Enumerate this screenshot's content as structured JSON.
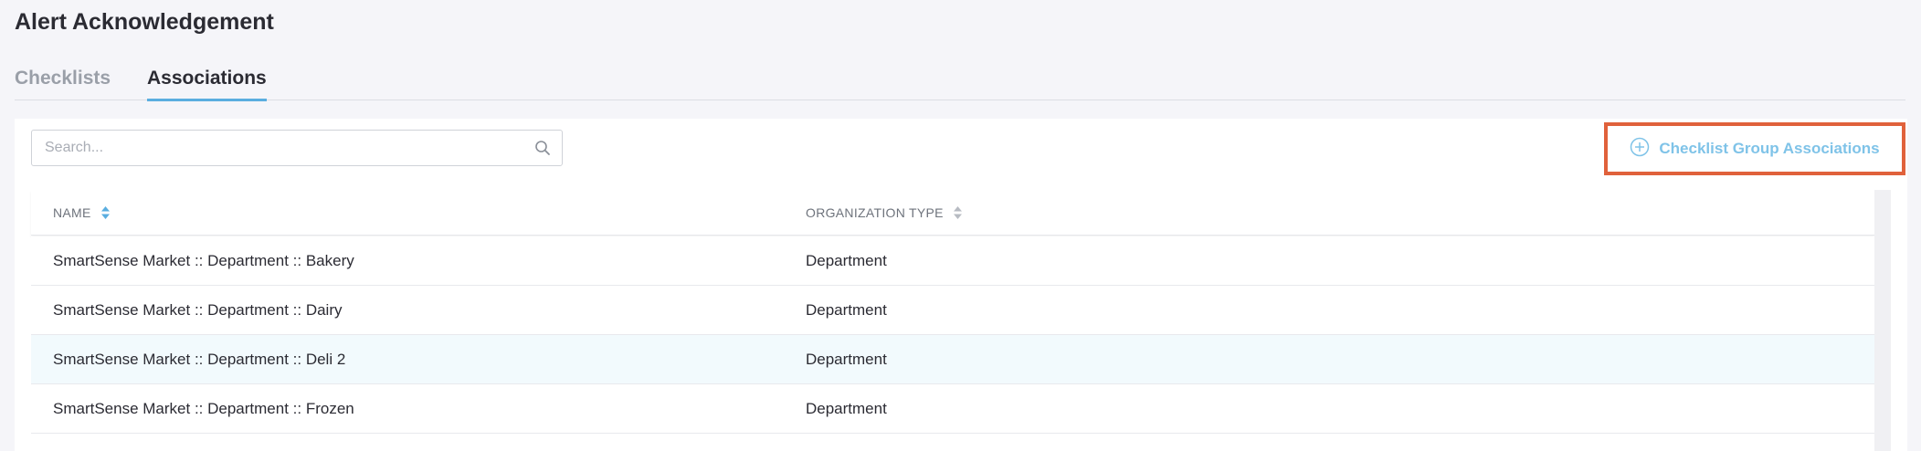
{
  "page": {
    "title": "Alert Acknowledgement"
  },
  "tabs": [
    {
      "label": "Checklists",
      "active": false
    },
    {
      "label": "Associations",
      "active": true
    }
  ],
  "toolbar": {
    "search_placeholder": "Search...",
    "search_value": "",
    "assoc_button_label": "Checklist Group Associations"
  },
  "table": {
    "columns": [
      "NAME",
      "ORGANIZATION TYPE"
    ],
    "rows": [
      {
        "name": "SmartSense Market :: Department :: Bakery",
        "org_type": "Department"
      },
      {
        "name": "SmartSense Market :: Department :: Dairy",
        "org_type": "Department"
      },
      {
        "name": "SmartSense Market :: Department :: Deli 2",
        "org_type": "Department"
      },
      {
        "name": "SmartSense Market :: Department :: Frozen",
        "org_type": "Department"
      }
    ]
  },
  "colors": {
    "accent": "#5aaee0",
    "button_text": "#7fc3e8",
    "highlight_border": "#e0613b",
    "row_highlight": "#f2fafd"
  },
  "icons": {
    "search": "search-icon",
    "add": "plus-circle-icon",
    "sort": "sort-icon"
  }
}
